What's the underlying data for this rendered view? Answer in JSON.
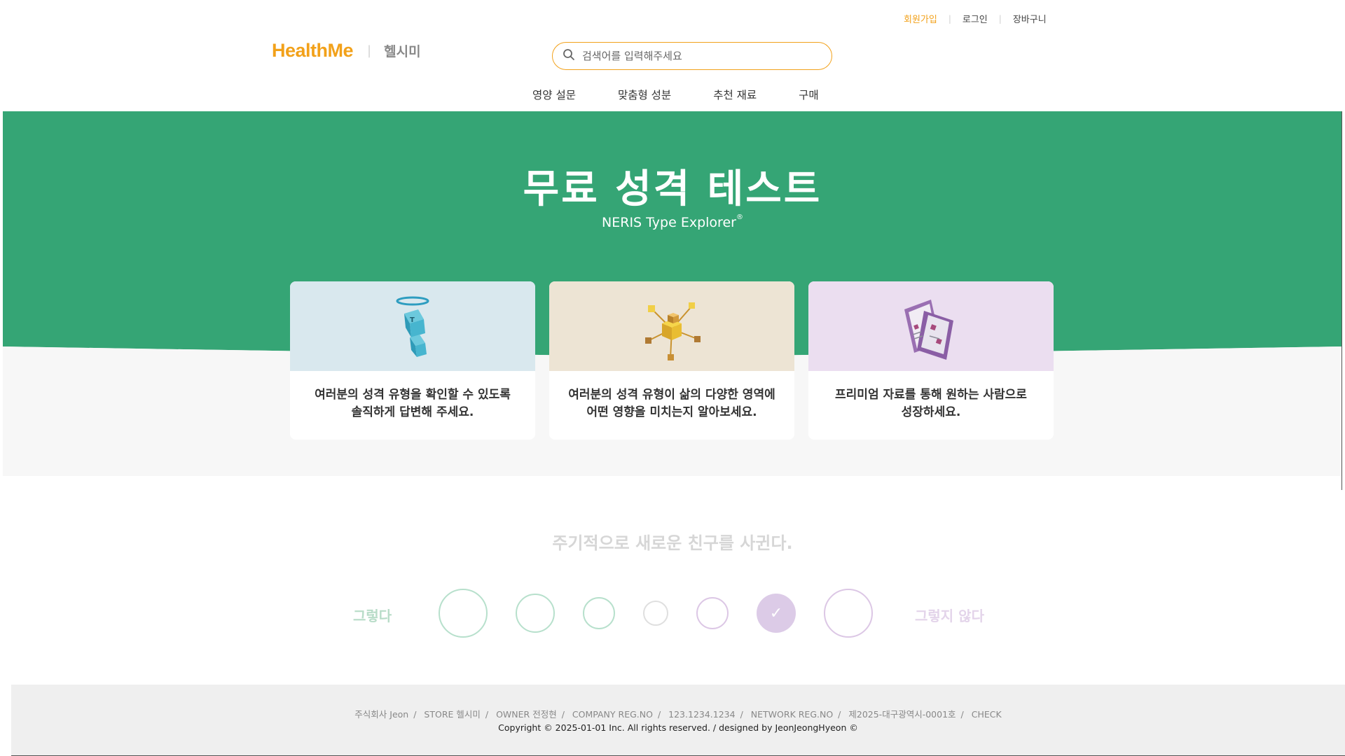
{
  "utility": {
    "join": "회원가입",
    "login": "로그인",
    "cart": "장바구니"
  },
  "header": {
    "brand": "HealthMe",
    "brand_kor": "헬시미"
  },
  "search": {
    "placeholder": "검색어를 입력해주세요"
  },
  "nav": [
    "영양 설문",
    "맞춤형 성분",
    "추천 재료",
    "구매"
  ],
  "hero": {
    "title": "무료 성격 테스트",
    "subtitle": "NERIS Type Explorer",
    "subtitle_mark": "®",
    "colors": {
      "green": "#35a575",
      "accent": "#f2a11a"
    }
  },
  "cards": [
    {
      "line1": "여러분의 성격 유형을 확인할 수 있도록",
      "line2": "솔직하게 답변해 주세요.",
      "icon": "blue-cube-figure-icon"
    },
    {
      "line1": "여러분의 성격 유형이 삶의 다양한 영역에",
      "line2": "어떤 영향을 미치는지 알아보세요.",
      "icon": "gold-cube-network-icon"
    },
    {
      "line1": "프리미엄 자료를 통해 원하는 사람으로",
      "line2": "성장하세요.",
      "icon": "purple-documents-icon"
    }
  ],
  "question": {
    "text": "주기적으로 새로운 친구를 사귄다.",
    "agree_label": "그렇다",
    "disagree_label": "그렇지 않다",
    "options_count": 7,
    "selected_index": 6,
    "check_glyph": "✓"
  },
  "footer": {
    "company": "주식회사 Jeon",
    "store": "STORE 헬시미",
    "owner": "OWNER 전정현",
    "reg_label": "COMPANY REG.NO",
    "reg_no": "123.1234.1234",
    "network_label": "NETWORK REG.NO",
    "network_no": "제2025-대구광역시-0001호",
    "check": "CHECK",
    "copyright": "Copyright © 2025-01-01 Inc. All rights reserved. / designed by JeonJeongHyeon ©"
  }
}
